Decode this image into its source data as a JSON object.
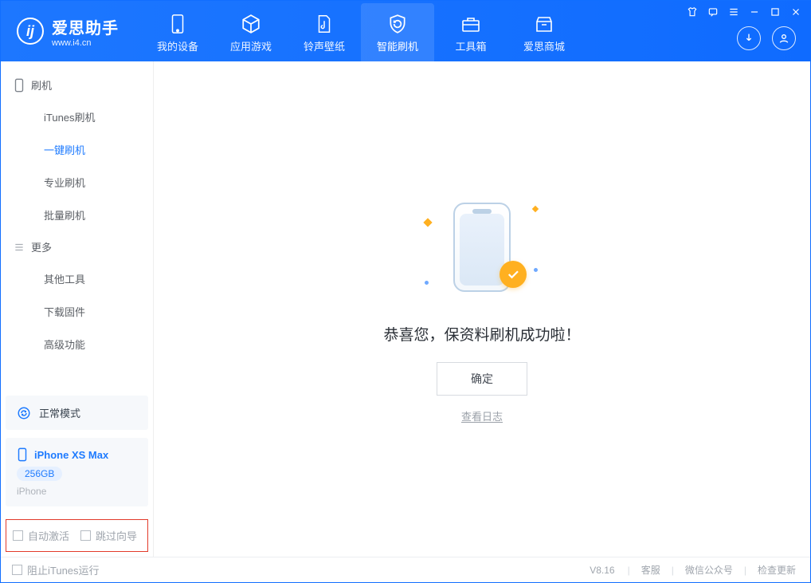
{
  "app": {
    "name_cn": "爱思助手",
    "url": "www.i4.cn"
  },
  "nav": {
    "items": [
      {
        "label": "我的设备",
        "icon": "device"
      },
      {
        "label": "应用游戏",
        "icon": "cube"
      },
      {
        "label": "铃声壁纸",
        "icon": "music"
      },
      {
        "label": "智能刷机",
        "icon": "refresh",
        "active": true
      },
      {
        "label": "工具箱",
        "icon": "toolbox"
      },
      {
        "label": "爱思商城",
        "icon": "store"
      }
    ]
  },
  "sidebar": {
    "groups": [
      {
        "title": "刷机",
        "items": [
          {
            "label": "iTunes刷机"
          },
          {
            "label": "一键刷机",
            "selected": true
          },
          {
            "label": "专业刷机"
          },
          {
            "label": "批量刷机"
          }
        ]
      },
      {
        "title": "更多",
        "items": [
          {
            "label": "其他工具"
          },
          {
            "label": "下载固件"
          },
          {
            "label": "高级功能"
          }
        ]
      }
    ],
    "status_label": "正常模式",
    "device": {
      "name": "iPhone XS Max",
      "capacity": "256GB",
      "type": "iPhone"
    },
    "options": {
      "opt1": "自动激活",
      "opt2": "跳过向导"
    }
  },
  "main": {
    "success_text": "恭喜您，保资料刷机成功啦！",
    "ok_button": "确定",
    "log_link": "查看日志"
  },
  "footer": {
    "block_itunes": "阻止iTunes运行",
    "version": "V8.16",
    "links": [
      "客服",
      "微信公众号",
      "检查更新"
    ]
  }
}
